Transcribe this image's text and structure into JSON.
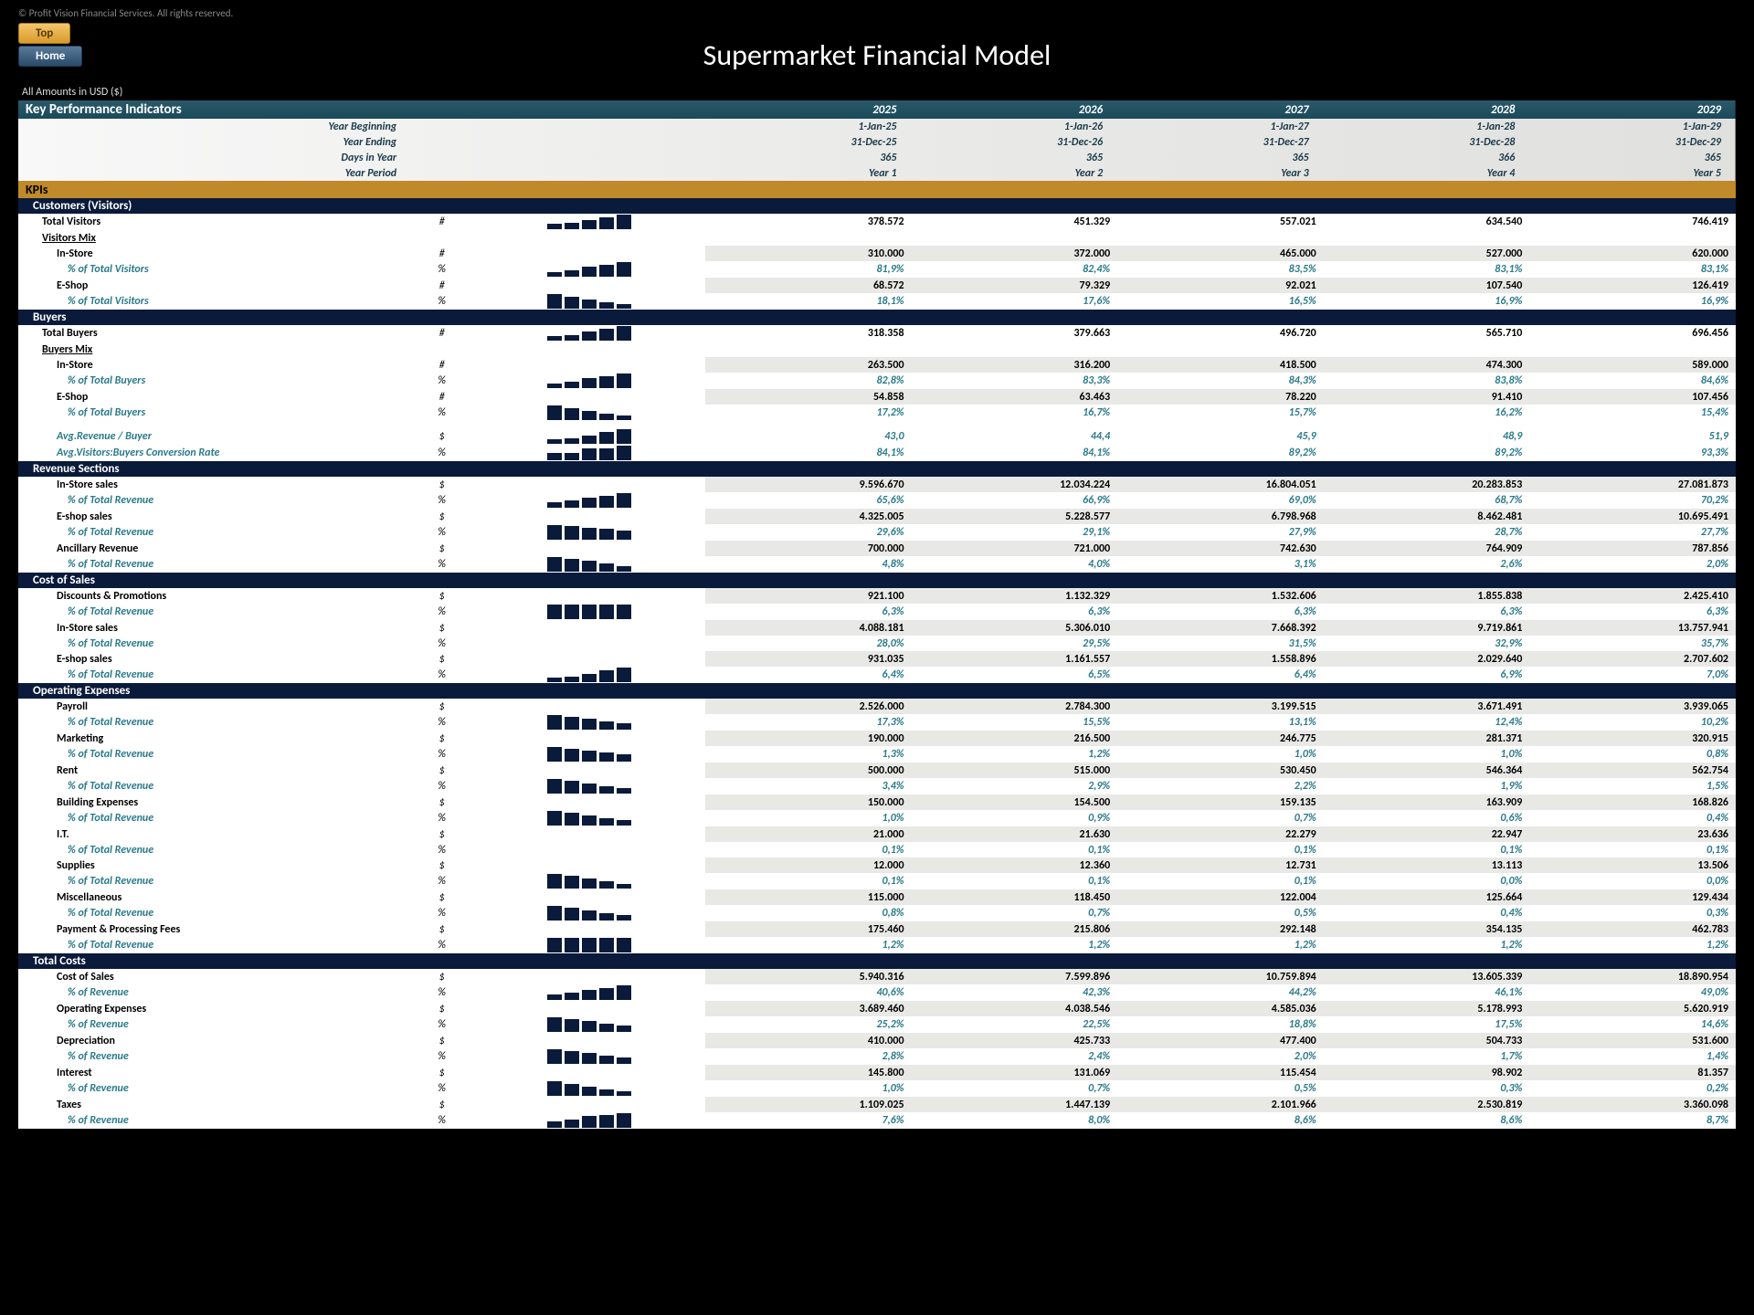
{
  "copyright": "© Profit Vision Financial Services. All rights reserved.",
  "btn_top": "Top",
  "btn_home": "Home",
  "title": "Supermarket Financial Model",
  "amounts": "All Amounts in  USD ($)",
  "headers": {
    "kpi": "Key Performance Indicators",
    "y": [
      "2025",
      "2026",
      "2027",
      "2028",
      "2029"
    ],
    "rows": [
      [
        "Year Beginning",
        "1-Jan-25",
        "1-Jan-26",
        "1-Jan-27",
        "1-Jan-28",
        "1-Jan-29"
      ],
      [
        "Year Ending",
        "31-Dec-25",
        "31-Dec-26",
        "31-Dec-27",
        "31-Dec-28",
        "31-Dec-29"
      ],
      [
        "Days in Year",
        "365",
        "365",
        "365",
        "366",
        "365"
      ],
      [
        "Year Period",
        "Year 1",
        "Year 2",
        "Year 3",
        "Year 4",
        "Year 5"
      ]
    ]
  },
  "kpis_label": "KPIs",
  "sections": [
    {
      "title": "Customers (Visitors)",
      "rows": [
        {
          "t": "b",
          "l": "Total Visitors",
          "u": "#",
          "sp": [
            8,
            12,
            18,
            24,
            32
          ],
          "v": [
            "378.572",
            "451.329",
            "557.021",
            "634.540",
            "746.419"
          ]
        },
        {
          "t": "sub",
          "l": "Visitors Mix"
        },
        {
          "t": "b1",
          "l": "In-Store",
          "u": "#",
          "sh": 1,
          "v": [
            "310.000",
            "372.000",
            "465.000",
            "527.000",
            "620.000"
          ]
        },
        {
          "t": "p2",
          "l": "% of Total Visitors",
          "u": "%",
          "sp": [
            6,
            12,
            20,
            26,
            32
          ],
          "v": [
            "81,9%",
            "82,4%",
            "83,5%",
            "83,1%",
            "83,1%"
          ]
        },
        {
          "t": "b1",
          "l": "E-Shop",
          "u": "#",
          "sh": 1,
          "v": [
            "68.572",
            "79.329",
            "92.021",
            "107.540",
            "126.419"
          ]
        },
        {
          "t": "p2",
          "l": "% of Total Visitors",
          "u": "%",
          "sp": [
            32,
            26,
            18,
            12,
            6
          ],
          "v": [
            "18,1%",
            "17,6%",
            "16,5%",
            "16,9%",
            "16,9%"
          ]
        }
      ]
    },
    {
      "title": "Buyers",
      "rows": [
        {
          "t": "b",
          "l": "Total Buyers",
          "u": "#",
          "sp": [
            6,
            10,
            18,
            24,
            32
          ],
          "v": [
            "318.358",
            "379.663",
            "496.720",
            "565.710",
            "696.456"
          ]
        },
        {
          "t": "sub",
          "l": "Buyers Mix"
        },
        {
          "t": "b1",
          "l": "In-Store",
          "u": "#",
          "sh": 1,
          "v": [
            "263.500",
            "316.200",
            "418.500",
            "474.300",
            "589.000"
          ]
        },
        {
          "t": "p2",
          "l": "% of Total Buyers",
          "u": "%",
          "sp": [
            6,
            12,
            20,
            26,
            32
          ],
          "v": [
            "82,8%",
            "83,3%",
            "84,3%",
            "83,8%",
            "84,6%"
          ]
        },
        {
          "t": "b1",
          "l": "E-Shop",
          "u": "#",
          "sh": 1,
          "v": [
            "54.858",
            "63.463",
            "78.220",
            "91.410",
            "107.456"
          ]
        },
        {
          "t": "p2",
          "l": "% of Total Buyers",
          "u": "%",
          "sp": [
            32,
            26,
            18,
            12,
            6
          ],
          "v": [
            "17,2%",
            "16,7%",
            "15,7%",
            "16,2%",
            "15,4%"
          ]
        },
        {
          "t": "gap"
        },
        {
          "t": "p1",
          "l": "Avg.Revenue / Buyer",
          "u": "$",
          "sp": [
            6,
            10,
            16,
            24,
            32
          ],
          "v": [
            "43,0",
            "44,4",
            "45,9",
            "48,9",
            "51,9"
          ]
        },
        {
          "t": "p1",
          "l": "Avg.Visitors:Buyers Conversion Rate",
          "u": "%",
          "sp": [
            14,
            14,
            24,
            24,
            32
          ],
          "v": [
            "84,1%",
            "84,1%",
            "89,2%",
            "89,2%",
            "93,3%"
          ]
        }
      ]
    },
    {
      "title": "Revenue Sections",
      "rows": [
        {
          "t": "b1",
          "l": "In-Store sales",
          "u": "$",
          "sh": 1,
          "v": [
            "9.596.670",
            "12.034.224",
            "16.804.051",
            "20.283.853",
            "27.081.873"
          ]
        },
        {
          "t": "p2",
          "l": "% of Total Revenue",
          "u": "%",
          "sp": [
            10,
            14,
            20,
            26,
            32
          ],
          "v": [
            "65,6%",
            "66,9%",
            "69,0%",
            "68,7%",
            "70,2%"
          ]
        },
        {
          "t": "b1",
          "l": "E-shop sales",
          "u": "$",
          "sh": 1,
          "v": [
            "4.325.005",
            "5.228.577",
            "6.798.968",
            "8.462.481",
            "10.695.491"
          ]
        },
        {
          "t": "p2",
          "l": "% of Total Revenue",
          "u": "%",
          "sp": [
            32,
            30,
            26,
            22,
            18
          ],
          "v": [
            "29,6%",
            "29,1%",
            "27,9%",
            "28,7%",
            "27,7%"
          ]
        },
        {
          "t": "b1",
          "l": "Ancillary Revenue",
          "u": "$",
          "sh": 1,
          "v": [
            "700.000",
            "721.000",
            "742.630",
            "764.909",
            "787.856"
          ]
        },
        {
          "t": "p2",
          "l": "% of Total Revenue",
          "u": "%",
          "sp": [
            32,
            28,
            22,
            16,
            10
          ],
          "v": [
            "4,8%",
            "4,0%",
            "3,1%",
            "2,6%",
            "2,0%"
          ]
        }
      ]
    },
    {
      "title": "Cost of Sales",
      "rows": [
        {
          "t": "b1",
          "l": "Discounts & Promotions",
          "u": "$",
          "sh": 1,
          "v": [
            "921.100",
            "1.132.329",
            "1.532.606",
            "1.855.838",
            "2.425.410"
          ]
        },
        {
          "t": "p2",
          "l": "% of Total Revenue",
          "u": "%",
          "sp": [
            24,
            24,
            24,
            24,
            24
          ],
          "v": [
            "6,3%",
            "6,3%",
            "6,3%",
            "6,3%",
            "6,3%"
          ]
        },
        {
          "t": "b1",
          "l": "In-Store sales",
          "u": "$",
          "sh": 1,
          "v": [
            "4.088.181",
            "5.306.010",
            "7.668.392",
            "9.719.861",
            "13.757.941"
          ]
        },
        {
          "t": "p2",
          "l": "% of Total Revenue",
          "u": "%",
          "v": [
            "28,0%",
            "29,5%",
            "31,5%",
            "32,9%",
            "35,7%"
          ]
        },
        {
          "t": "b1",
          "l": "E-shop sales",
          "u": "$",
          "sh": 1,
          "v": [
            "931.035",
            "1.161.557",
            "1.558.896",
            "2.029.640",
            "2.707.602"
          ]
        },
        {
          "t": "p2",
          "l": "% of Total Revenue",
          "u": "%",
          "sp": [
            6,
            10,
            16,
            24,
            32
          ],
          "v": [
            "6,4%",
            "6,5%",
            "6,4%",
            "6,9%",
            "7,0%"
          ]
        }
      ]
    },
    {
      "title": "Operating Expenses",
      "rows": [
        {
          "t": "b1",
          "l": "Payroll",
          "u": "$",
          "sh": 1,
          "v": [
            "2.526.000",
            "2.784.300",
            "3.199.515",
            "3.671.491",
            "3.939.065"
          ]
        },
        {
          "t": "p2",
          "l": "% of Total Revenue",
          "u": "%",
          "sp": [
            32,
            28,
            22,
            16,
            12
          ],
          "v": [
            "17,3%",
            "15,5%",
            "13,1%",
            "12,4%",
            "10,2%"
          ]
        },
        {
          "t": "b1",
          "l": "Marketing",
          "u": "$",
          "sh": 1,
          "v": [
            "190.000",
            "216.500",
            "246.775",
            "281.371",
            "320.915"
          ]
        },
        {
          "t": "p2",
          "l": "% of Total Revenue",
          "u": "%",
          "sp": [
            32,
            28,
            22,
            18,
            14
          ],
          "v": [
            "1,3%",
            "1,2%",
            "1,0%",
            "1,0%",
            "0,8%"
          ]
        },
        {
          "t": "b1",
          "l": "Rent",
          "u": "$",
          "sh": 1,
          "v": [
            "500.000",
            "515.000",
            "530.450",
            "546.364",
            "562.754"
          ]
        },
        {
          "t": "p2",
          "l": "% of Total Revenue",
          "u": "%",
          "sp": [
            32,
            28,
            20,
            14,
            10
          ],
          "v": [
            "3,4%",
            "2,9%",
            "2,2%",
            "1,9%",
            "1,5%"
          ]
        },
        {
          "t": "b1",
          "l": "Building Expenses",
          "u": "$",
          "sh": 1,
          "v": [
            "150.000",
            "154.500",
            "159.135",
            "163.909",
            "168.826"
          ]
        },
        {
          "t": "p2",
          "l": "% of Total Revenue",
          "u": "%",
          "sp": [
            32,
            28,
            20,
            14,
            8
          ],
          "v": [
            "1,0%",
            "0,9%",
            "0,7%",
            "0,6%",
            "0,4%"
          ]
        },
        {
          "t": "b1",
          "l": "I.T.",
          "u": "$",
          "sh": 1,
          "v": [
            "21.000",
            "21.630",
            "22.279",
            "22.947",
            "23.636"
          ]
        },
        {
          "t": "p2",
          "l": "% of Total Revenue",
          "u": "%",
          "v": [
            "0,1%",
            "0,1%",
            "0,1%",
            "0,1%",
            "0,1%"
          ]
        },
        {
          "t": "b1",
          "l": "Supplies",
          "u": "$",
          "sh": 1,
          "v": [
            "12.000",
            "12.360",
            "12.731",
            "13.113",
            "13.506"
          ]
        },
        {
          "t": "p2",
          "l": "% of Total Revenue",
          "u": "%",
          "sp": [
            32,
            28,
            20,
            14,
            6
          ],
          "v": [
            "0,1%",
            "0,1%",
            "0,1%",
            "0,0%",
            "0,0%"
          ]
        },
        {
          "t": "b1",
          "l": "Miscellaneous",
          "u": "$",
          "sh": 1,
          "v": [
            "115.000",
            "118.450",
            "122.004",
            "125.664",
            "129.434"
          ]
        },
        {
          "t": "p2",
          "l": "% of Total Revenue",
          "u": "%",
          "sp": [
            32,
            28,
            20,
            14,
            8
          ],
          "v": [
            "0,8%",
            "0,7%",
            "0,5%",
            "0,4%",
            "0,3%"
          ]
        },
        {
          "t": "b1",
          "l": "Payment & Processing Fees",
          "u": "$",
          "sh": 1,
          "v": [
            "175.460",
            "215.806",
            "292.148",
            "354.135",
            "462.783"
          ]
        },
        {
          "t": "p2",
          "l": "% of Total Revenue",
          "u": "%",
          "sp": [
            24,
            24,
            24,
            24,
            24
          ],
          "v": [
            "1,2%",
            "1,2%",
            "1,2%",
            "1,2%",
            "1,2%"
          ]
        }
      ]
    },
    {
      "title": "Total Costs",
      "rows": [
        {
          "t": "b1",
          "l": "Cost of Sales",
          "u": "$",
          "sh": 1,
          "v": [
            "5.940.316",
            "7.599.896",
            "10.759.894",
            "13.605.339",
            "18.890.954"
          ]
        },
        {
          "t": "p2",
          "l": "% of Revenue",
          "u": "%",
          "sp": [
            10,
            14,
            20,
            26,
            32
          ],
          "v": [
            "40,6%",
            "42,3%",
            "44,2%",
            "46,1%",
            "49,0%"
          ]
        },
        {
          "t": "b1",
          "l": "Operating Expenses",
          "u": "$",
          "sh": 1,
          "v": [
            "3.689.460",
            "4.038.546",
            "4.585.036",
            "5.178.993",
            "5.620.919"
          ]
        },
        {
          "t": "p2",
          "l": "% of Revenue",
          "u": "%",
          "sp": [
            32,
            28,
            22,
            16,
            12
          ],
          "v": [
            "25,2%",
            "22,5%",
            "18,8%",
            "17,5%",
            "14,6%"
          ]
        },
        {
          "t": "b1",
          "l": "Depreciation",
          "u": "$",
          "sh": 1,
          "v": [
            "410.000",
            "425.733",
            "477.400",
            "504.733",
            "531.600"
          ]
        },
        {
          "t": "p2",
          "l": "% of Revenue",
          "u": "%",
          "sp": [
            32,
            28,
            22,
            16,
            12
          ],
          "v": [
            "2,8%",
            "2,4%",
            "2,0%",
            "1,7%",
            "1,4%"
          ]
        },
        {
          "t": "b1",
          "l": "Interest",
          "u": "$",
          "sh": 1,
          "v": [
            "145.800",
            "131.069",
            "115.454",
            "98.902",
            "81.357"
          ]
        },
        {
          "t": "p2",
          "l": "% of Revenue",
          "u": "%",
          "sp": [
            32,
            24,
            18,
            12,
            6
          ],
          "v": [
            "1,0%",
            "0,7%",
            "0,5%",
            "0,3%",
            "0,2%"
          ]
        },
        {
          "t": "b1",
          "l": "Taxes",
          "u": "$",
          "sh": 1,
          "v": [
            "1.109.025",
            "1.447.139",
            "2.101.966",
            "2.530.819",
            "3.360.098"
          ]
        },
        {
          "t": "p2",
          "l": "% of Revenue",
          "u": "%",
          "sp": [
            12,
            16,
            24,
            28,
            32
          ],
          "v": [
            "7,6%",
            "8,0%",
            "8,6%",
            "8,6%",
            "8,7%"
          ]
        }
      ]
    }
  ]
}
